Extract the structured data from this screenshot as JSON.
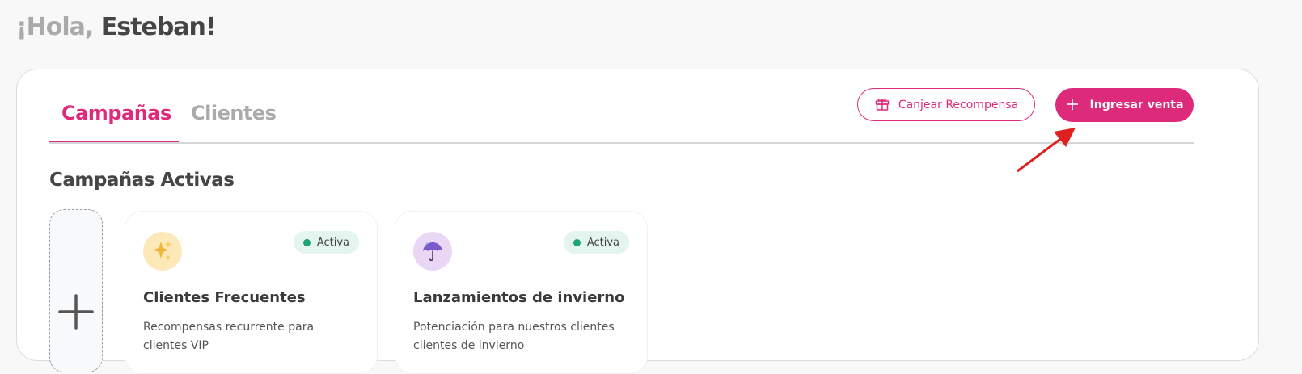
{
  "greeting": {
    "hola": "¡Hola,",
    "name": "Esteban!"
  },
  "tabs": [
    {
      "label": "Campañas",
      "active": true
    },
    {
      "label": "Clientes",
      "active": false
    }
  ],
  "actions": {
    "redeem_label": "Canjear Recompensa",
    "redeem_icon": "gift-icon",
    "new_sale_label": "Ingresar venta",
    "new_sale_icon": "plus-icon"
  },
  "section_title": "Campañas Activas",
  "add_card": {
    "icon": "plus-icon"
  },
  "campaigns": [
    {
      "icon": "sparkles-icon",
      "icon_bg": "#fde9b8",
      "status": "Activa",
      "title": "Clientes Frecuentes",
      "description": "Recompensas recurrente para clientes VIP"
    },
    {
      "icon": "umbrella-icon",
      "icon_bg": "#ead7f6",
      "status": "Activa",
      "title": "Lanzamientos de invierno",
      "description": "Potenciación para nuestros clientes clientes de invierno"
    }
  ],
  "colors": {
    "accent": "#dd2a7b",
    "status_dot": "#1ba37a",
    "status_bg": "#e3f5ee",
    "annotation_arrow": "#e02020"
  }
}
